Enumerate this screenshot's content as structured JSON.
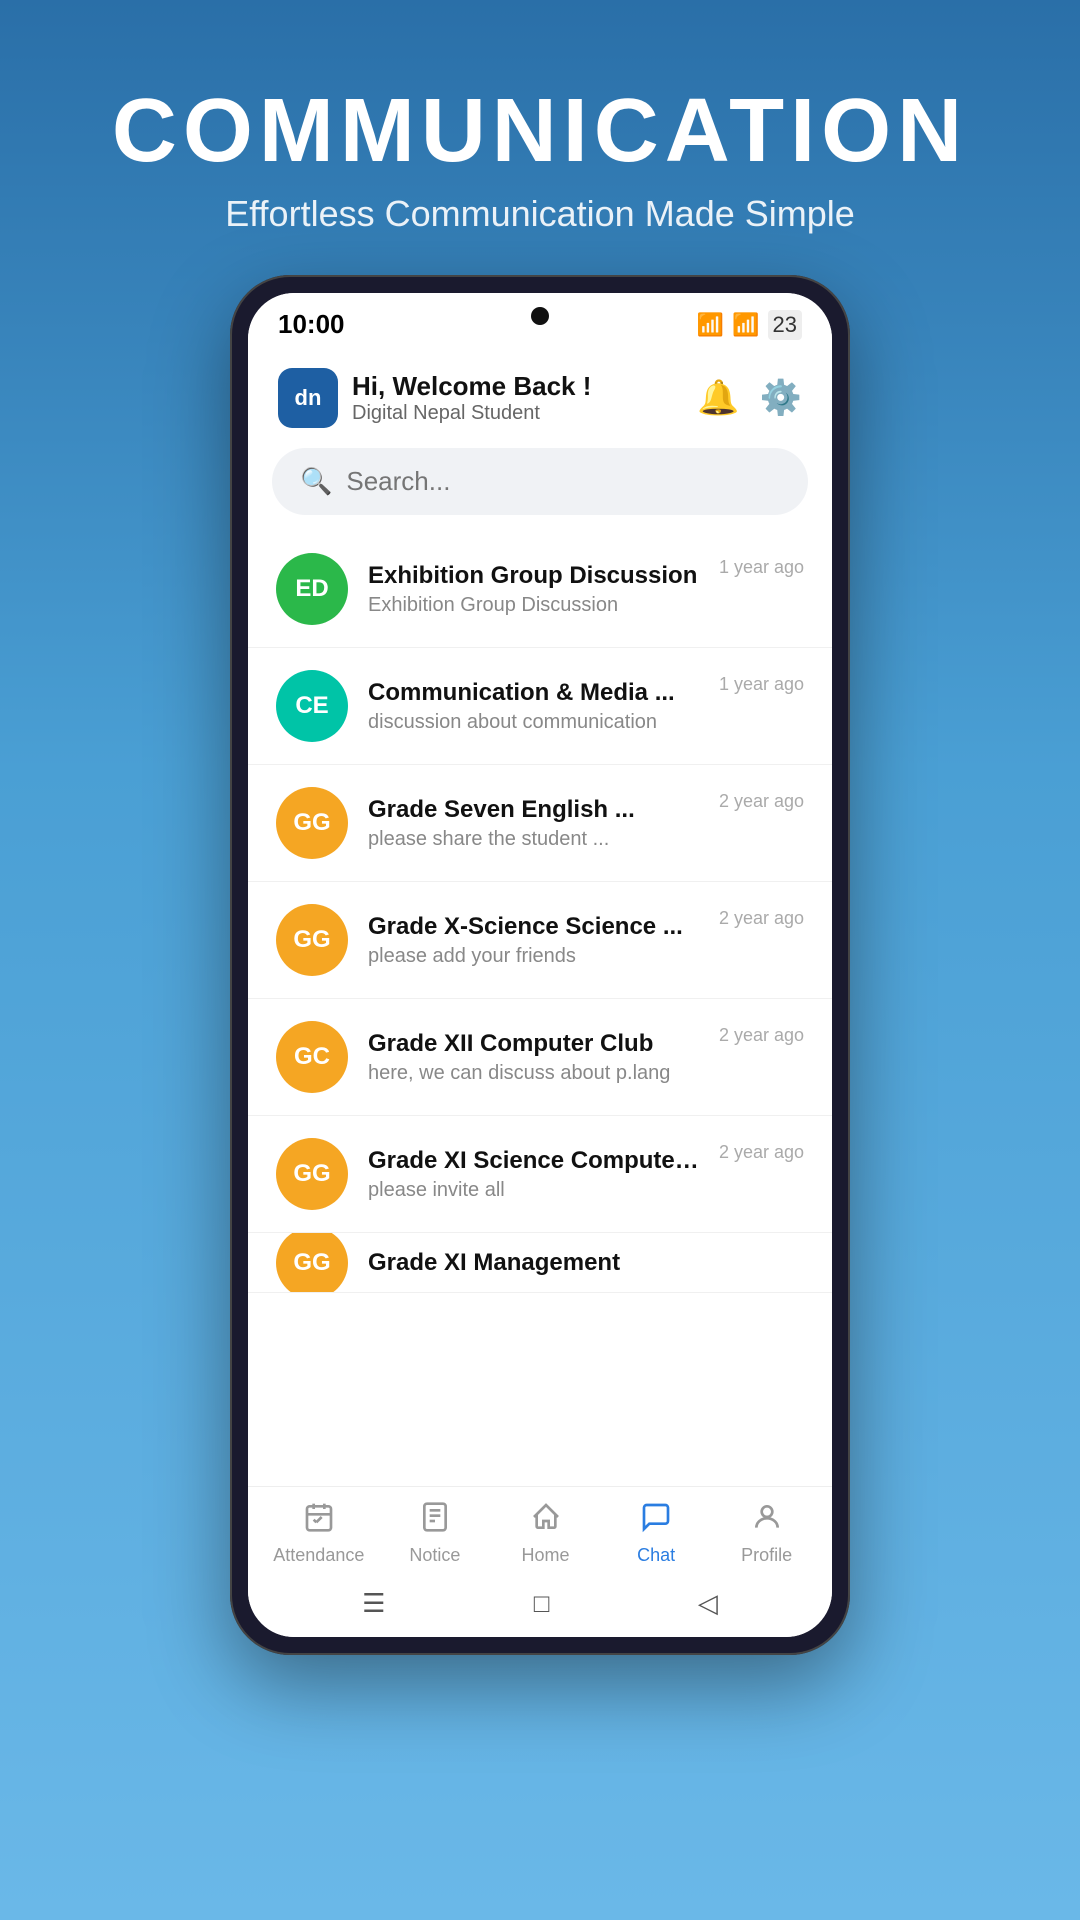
{
  "page": {
    "title": "COMMUNICATION",
    "subtitle": "Effortless Communication Made Simple"
  },
  "statusBar": {
    "time": "10:00",
    "batteryLevel": "23"
  },
  "header": {
    "greeting": "Hi, Welcome Back !",
    "username": "Digital Nepal Student",
    "logoText": "dn",
    "bellLabel": "notifications",
    "settingsLabel": "settings"
  },
  "search": {
    "placeholder": "Search..."
  },
  "chatList": [
    {
      "id": 1,
      "initials": "ED",
      "avatarClass": "avatar-green",
      "name": "Exhibition Group Discussion",
      "preview": "Exhibition Group Discussion",
      "time": "1 year ago"
    },
    {
      "id": 2,
      "initials": "CE",
      "avatarClass": "avatar-teal",
      "name": "Communication & Media ...",
      "preview": "discussion about communication",
      "time": "1 year ago"
    },
    {
      "id": 3,
      "initials": "GG",
      "avatarClass": "avatar-orange",
      "name": "Grade Seven English ...",
      "preview": "please share the student ...",
      "time": "2 year ago"
    },
    {
      "id": 4,
      "initials": "GG",
      "avatarClass": "avatar-orange",
      "name": "Grade X-Science Science ...",
      "preview": "please add your friends",
      "time": "2 year ago"
    },
    {
      "id": 5,
      "initials": "GC",
      "avatarClass": "avatar-orange",
      "name": "Grade XII Computer Club",
      "preview": "here, we can discuss about p.lang",
      "time": "2 year ago"
    },
    {
      "id": 6,
      "initials": "GG",
      "avatarClass": "avatar-orange",
      "name": "Grade XI Science Computer ...",
      "preview": "please invite all",
      "time": "2 year ago"
    },
    {
      "id": 7,
      "initials": "GG",
      "avatarClass": "avatar-orange",
      "name": "Grade XI Management",
      "preview": "",
      "time": ""
    }
  ],
  "bottomNav": [
    {
      "id": "attendance",
      "label": "Attendance",
      "icon": "📋",
      "active": false
    },
    {
      "id": "notice",
      "label": "Notice",
      "icon": "📄",
      "active": false
    },
    {
      "id": "home",
      "label": "Home",
      "icon": "🏠",
      "active": false
    },
    {
      "id": "chat",
      "label": "Chat",
      "icon": "💬",
      "active": true
    },
    {
      "id": "profile",
      "label": "Profile",
      "icon": "👤",
      "active": false
    }
  ],
  "systemNav": {
    "menu": "☰",
    "square": "□",
    "back": "◁"
  }
}
